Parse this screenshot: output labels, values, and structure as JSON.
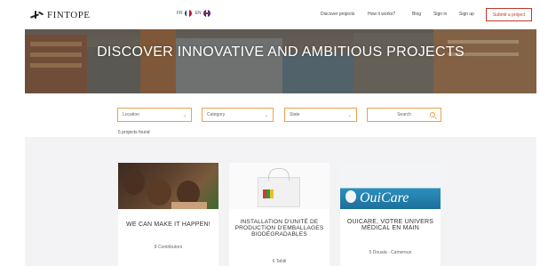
{
  "header": {
    "logo_text": "FINTOPE",
    "lang_fr": "FR",
    "lang_en": "EN",
    "nav": [
      "Discover projects",
      "How it works?",
      "Blog",
      "Sign in",
      "Sign up"
    ],
    "deposit_label": "Submit a project"
  },
  "hero": {
    "title": "DISCOVER INNOVATIVE AND AMBITIOUS PROJECTS"
  },
  "filters": {
    "location": "Location",
    "category": "Category",
    "state": "State",
    "search": "Search"
  },
  "results": {
    "count_text": "5 projects found"
  },
  "cards": [
    {
      "title": "WE CAN MAKE IT HAPPEN!",
      "meta": "8 Contributors"
    },
    {
      "title": "INSTALLATION D'UNITÉ DE PRODUCTION D'EMBALLAGES BIODÉGRADABLES",
      "meta": "6 Tahiti"
    },
    {
      "title": "OUICARE, VOTRE UNIVERS MÉDICAL EN MAIN",
      "meta": "5 Douala - Cameroun",
      "brand": "OuiCare"
    }
  ],
  "colors": {
    "accent": "#e8a24a",
    "deposit": "#c0392b",
    "band": "#f3f3f5"
  }
}
